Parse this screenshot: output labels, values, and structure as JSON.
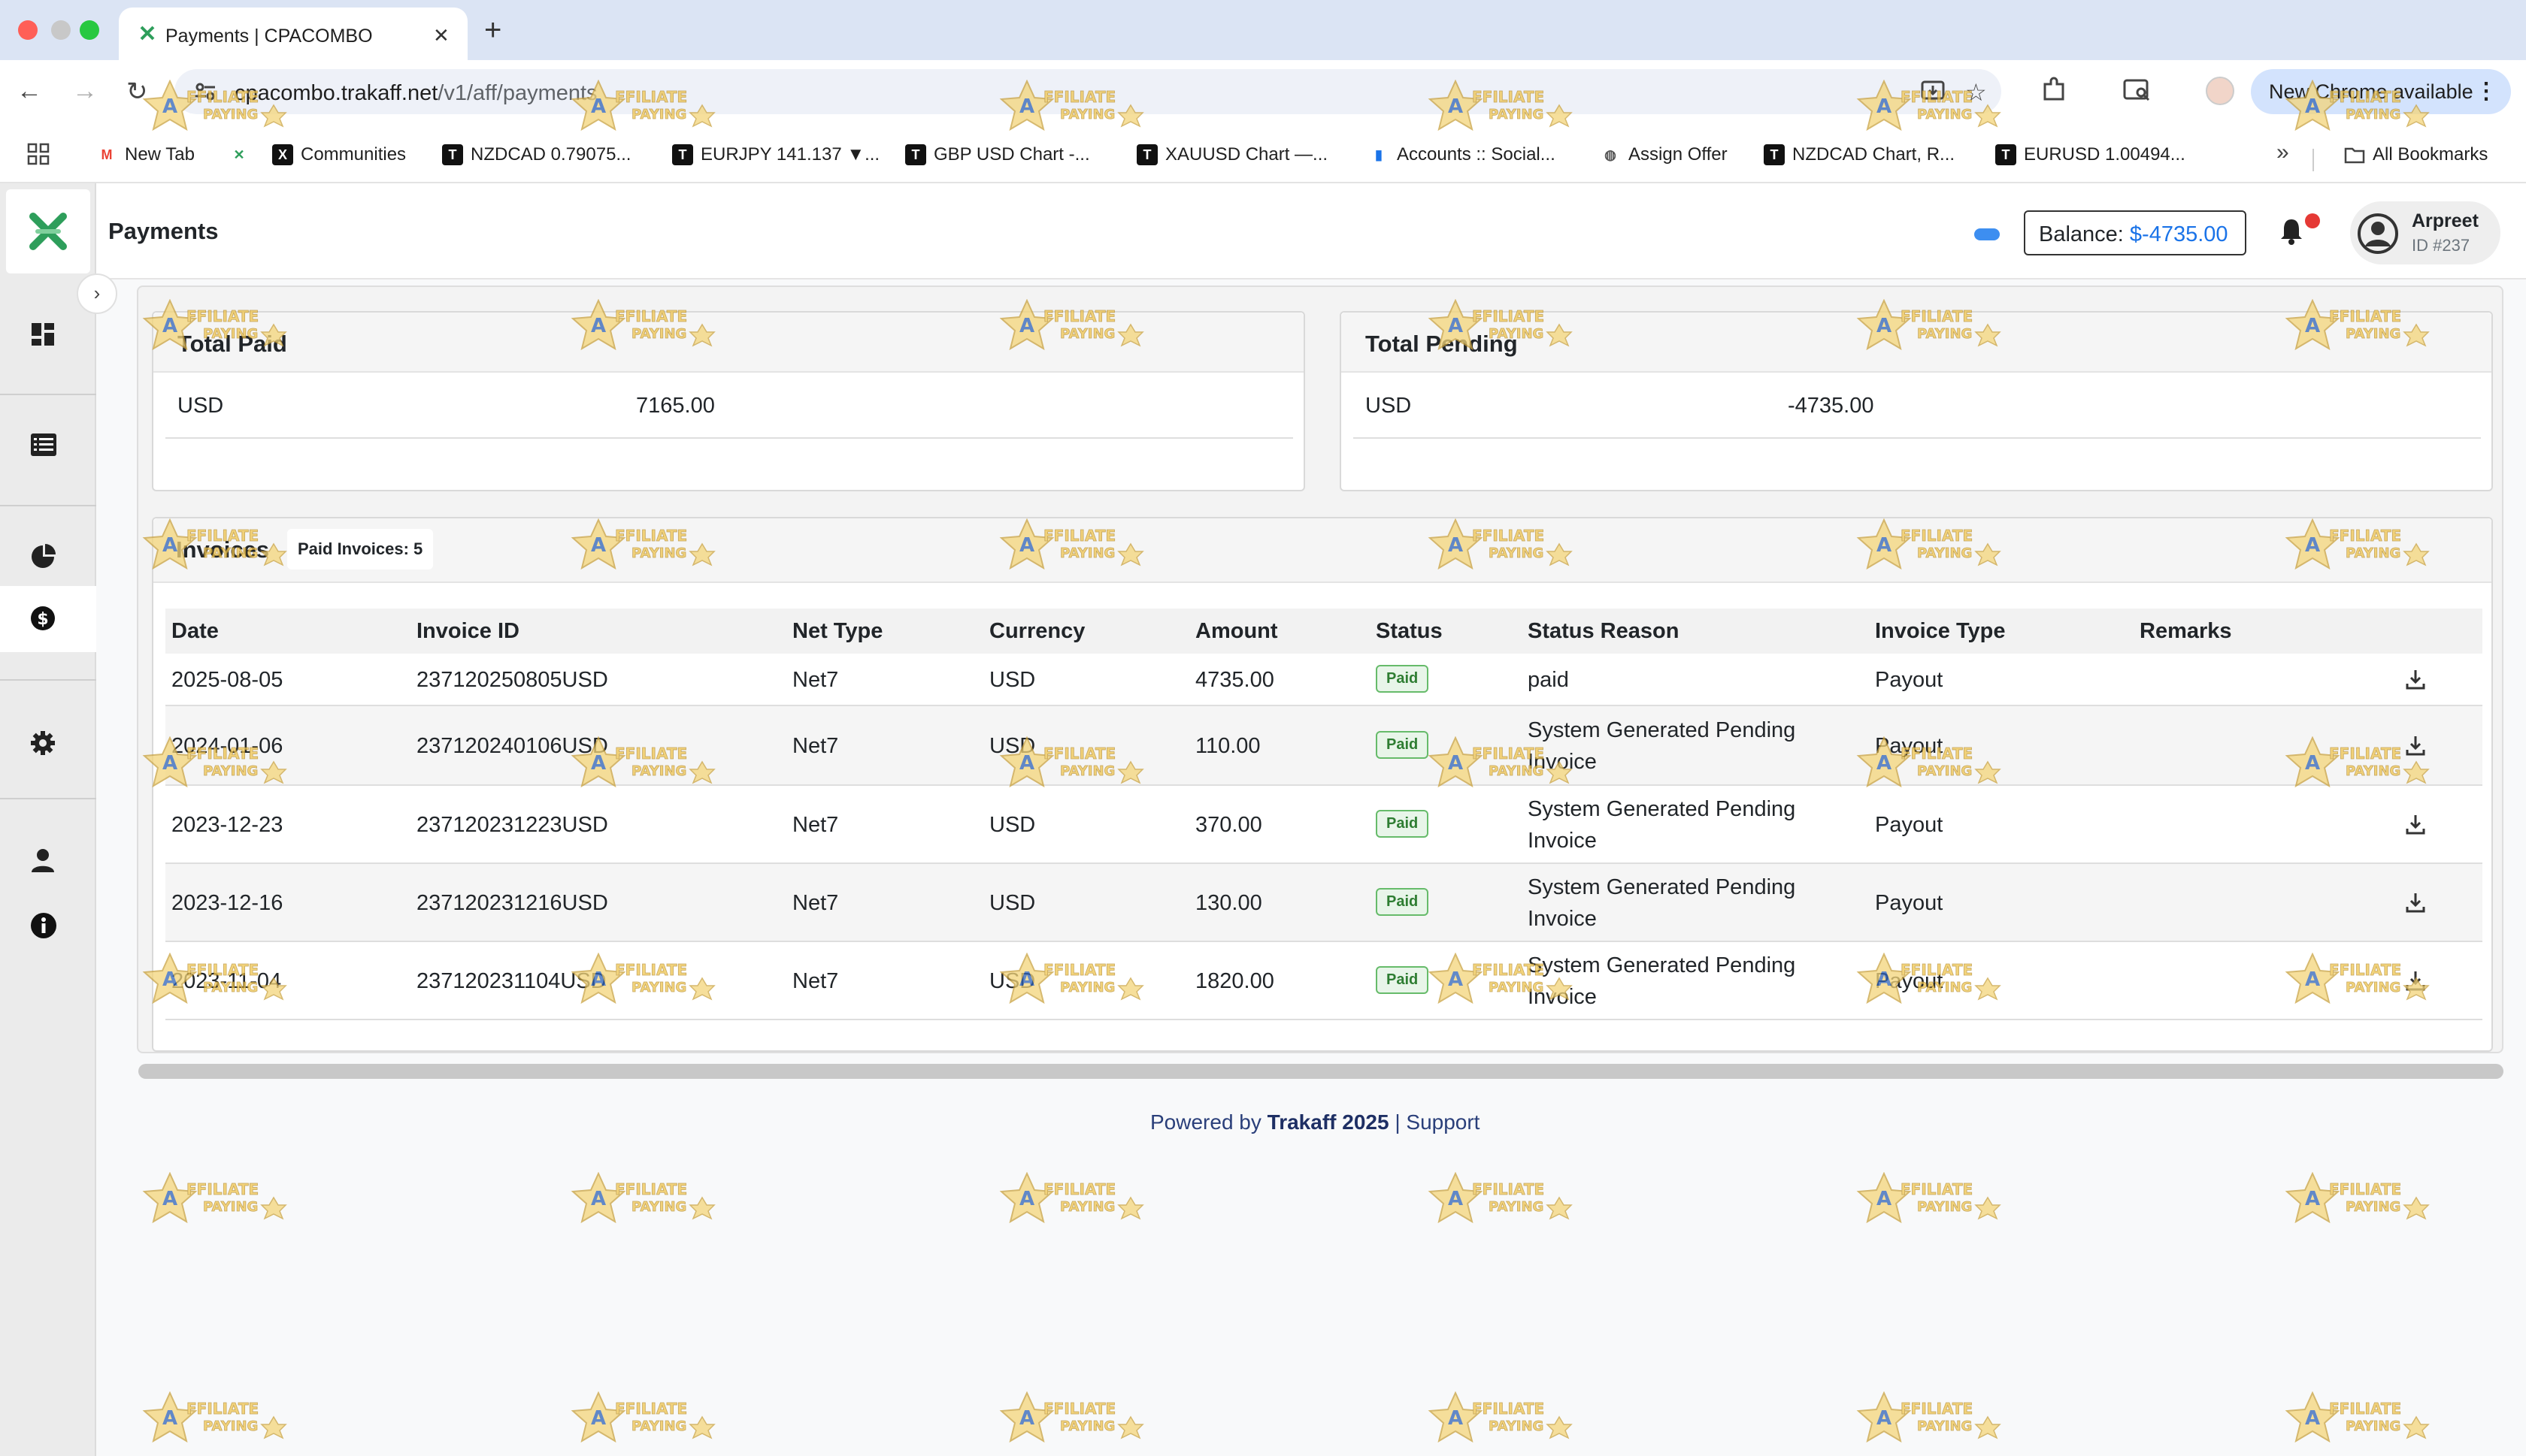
{
  "browser": {
    "tab_title": "Payments | CPACOMBO",
    "url_host": "cpacombo.trakaff.net",
    "url_path": "/v1/aff/payments",
    "update_label": "New Chrome available",
    "bookmarks": [
      {
        "label": "New Tab",
        "icon": "gmail-icon"
      },
      {
        "label": "",
        "icon": "trakaff-icon"
      },
      {
        "label": "Communities",
        "icon": "x-icon"
      },
      {
        "label": "NZDCAD 0.79075...",
        "icon": "tradingview-icon"
      },
      {
        "label": "EURJPY 141.137 ▼...",
        "icon": "tradingview-icon"
      },
      {
        "label": "GBP USD Chart -...",
        "icon": "tradingview-icon"
      },
      {
        "label": "XAUUSD Chart —...",
        "icon": "tradingview-icon"
      },
      {
        "label": "Accounts :: Social...",
        "icon": "bars-icon"
      },
      {
        "label": "Assign Offer",
        "icon": "globe-icon"
      },
      {
        "label": "NZDCAD Chart, R...",
        "icon": "tradingview-icon"
      },
      {
        "label": "EURUSD 1.00494...",
        "icon": "tradingview-icon"
      }
    ],
    "all_bookmarks_label": "All Bookmarks"
  },
  "header": {
    "title": "Payments",
    "balance_label": "Balance:",
    "balance_value": "$-4735.00",
    "user_name": "Arpreet",
    "user_id": "ID #237"
  },
  "total_paid": {
    "title": "Total Paid",
    "currency": "USD",
    "amount": "7165.00"
  },
  "total_pending": {
    "title": "Total Pending",
    "currency": "USD",
    "amount": "-4735.00"
  },
  "invoices": {
    "title": "Invoices",
    "paid_badge": "Paid Invoices: 5",
    "columns": [
      "Date",
      "Invoice ID",
      "Net Type",
      "Currency",
      "Amount",
      "Status",
      "Status Reason",
      "Invoice Type",
      "Remarks"
    ],
    "rows": [
      {
        "date": "2025-08-05",
        "id": "237120250805USD",
        "net": "Net7",
        "currency": "USD",
        "amount": "4735.00",
        "status": "Paid",
        "reason": [
          "paid"
        ],
        "type": "Payout",
        "remarks": ""
      },
      {
        "date": "2024-01-06",
        "id": "237120240106USD",
        "net": "Net7",
        "currency": "USD",
        "amount": "110.00",
        "status": "Paid",
        "reason": [
          "System Generated Pending",
          "Invoice"
        ],
        "type": "Payout",
        "remarks": ""
      },
      {
        "date": "2023-12-23",
        "id": "237120231223USD",
        "net": "Net7",
        "currency": "USD",
        "amount": "370.00",
        "status": "Paid",
        "reason": [
          "System Generated Pending",
          "Invoice"
        ],
        "type": "Payout",
        "remarks": ""
      },
      {
        "date": "2023-12-16",
        "id": "237120231216USD",
        "net": "Net7",
        "currency": "USD",
        "amount": "130.00",
        "status": "Paid",
        "reason": [
          "System Generated Pending",
          "Invoice"
        ],
        "type": "Payout",
        "remarks": ""
      },
      {
        "date": "2023-11-04",
        "id": "237120231104USD",
        "net": "Net7",
        "currency": "USD",
        "amount": "1820.00",
        "status": "Paid",
        "reason": [
          "System Generated Pending",
          "Invoice"
        ],
        "type": "Payout",
        "remarks": ""
      }
    ]
  },
  "footer": {
    "prefix": "Powered by",
    "brand": "Trakaff 2025",
    "separator": "|",
    "support": "Support"
  },
  "watermark": {
    "line1": "AFFILIATE",
    "line2": "PAYING"
  },
  "colors": {
    "accent": "#1a73e8",
    "logo_green": "#2e9e5b",
    "paid_green": "#2e7d32",
    "notification_red": "#e53935"
  }
}
